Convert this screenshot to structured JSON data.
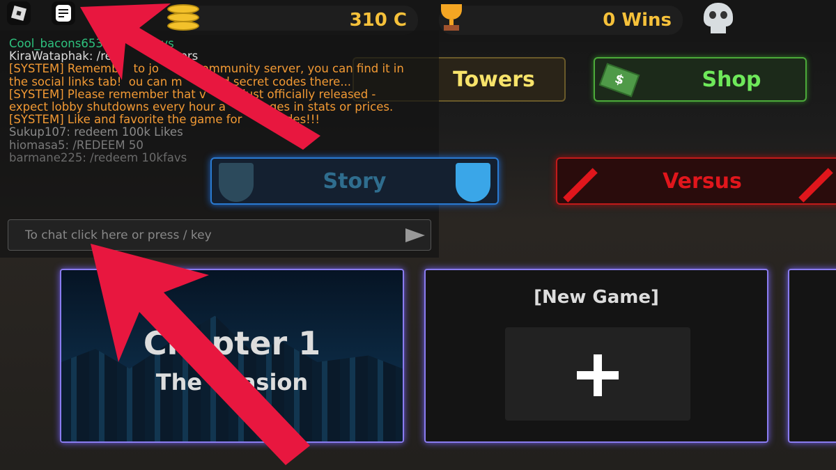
{
  "topbar": {
    "coins": "310 C",
    "wins": "0 Wins",
    "coin_icon": "coin-stack-icon",
    "trophy_icon": "trophy-icon",
    "skull_icon": "skull-icon"
  },
  "menu": {
    "towers": "Towers",
    "shop": "Shop",
    "story": "Story",
    "versus": "Versus"
  },
  "chat": {
    "lines": [
      {
        "text": "Cool_bacons653              avs",
        "color": "#2ec27e"
      },
      {
        "text": "KiraWataphak: /re              layers",
        "color": "#dddddd"
      },
      {
        "prefix": "[SYSTEM]",
        "text": " Rememb    to jo          community server, you can find it in"
      },
      {
        "text": "the social links tab!  ou can m         nd secret codes there...",
        "color": "#f39a34"
      },
      {
        "prefix": "[SYSTEM]",
        "text": " Please remember that v          just officially released -"
      },
      {
        "text": "expect lobby shutdowns every hour a          nges in stats or prices.",
        "color": "#f39a34"
      },
      {
        "prefix": "[SYSTEM]",
        "text": " Like and favorite the game for          odes!!!"
      },
      {
        "text": "Sukup107: redeem 100k Likes",
        "color": "#8a8a8a"
      },
      {
        "text": "hiomasa5: /REDEEM 50",
        "color": "#7a7a7a"
      },
      {
        "text": "barmane225: /redeem 10kfavs",
        "color": "#6a6a6a"
      }
    ],
    "placeholder": "To chat click here or press / key"
  },
  "cards": {
    "chapter_title": "Chapter 1",
    "chapter_subtitle": "The     asion",
    "new_game": "[New Game]"
  },
  "colors": {
    "accent_gold": "#f6c13a",
    "shop_green": "#6ee85a",
    "versus_red": "#e0161c",
    "story_blue": "#3aa6e8",
    "arrow_red": "#e8173f"
  }
}
